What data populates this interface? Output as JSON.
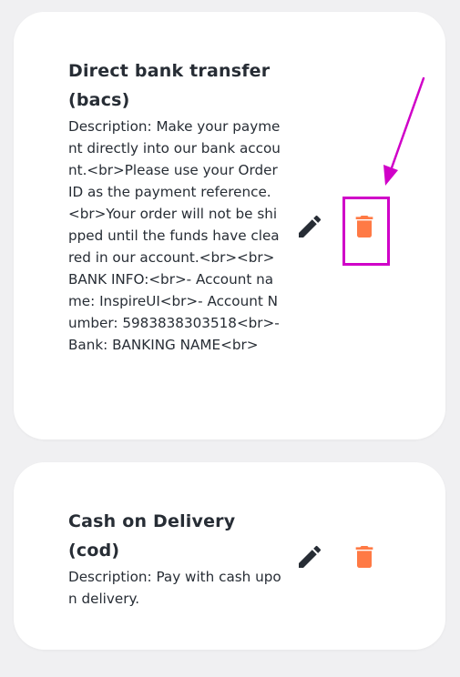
{
  "colors": {
    "card_background": "#ffffff",
    "page_background": "#f0f0f2",
    "text": "#272d35",
    "edit_icon": "#272d35",
    "delete_icon": "#ff7a45",
    "annotation": "#d000c8"
  },
  "payment_methods": [
    {
      "title": "Direct bank transfer\n(bacs)",
      "description": "Description: Make your payment directly into our bank account.<br>Please use your Order ID as the payment reference.<br>Your order will not be shipped until the funds have cleared in our account.<br><br>BANK INFO:<br>- Account name: InspireUI<br>- Account Number: 5983838303518<br>- Bank: BANKING NAME<br>",
      "edit_icon": "pencil-icon",
      "delete_icon": "trash-icon"
    },
    {
      "title": "Cash on Delivery\n(cod)",
      "description": "Description: Pay with cash upon delivery.",
      "edit_icon": "pencil-icon",
      "delete_icon": "trash-icon"
    }
  ],
  "annotation": {
    "target": "delete-button",
    "icon": "arrow-icon"
  }
}
